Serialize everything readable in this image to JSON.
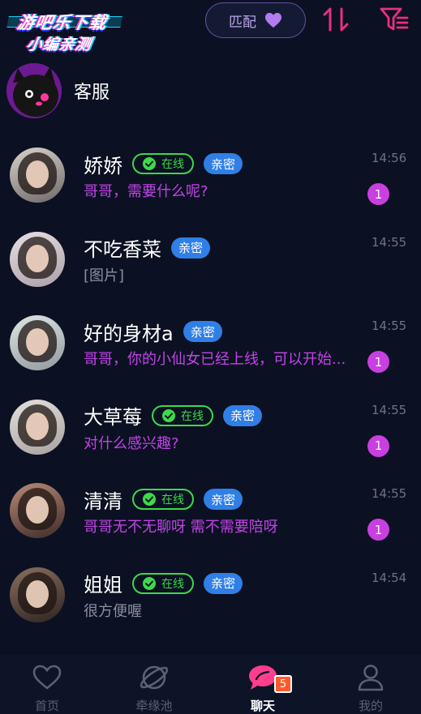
{
  "header": {
    "logo_line1": "游吧乐下载",
    "logo_line2": "小编亲测",
    "match_label": "匹配",
    "sort_icon": "sort-arrows-icon",
    "filter_icon": "filter-icon"
  },
  "service": {
    "label": "客服"
  },
  "chats": [
    {
      "name": "娇娇",
      "online": true,
      "online_label": "在线",
      "tag": "亲密",
      "message": "哥哥，需要什么呢?",
      "message_style": "pink",
      "time": "14:56",
      "unread": "1"
    },
    {
      "name": "不吃香菜",
      "online": false,
      "tag": "亲密",
      "message": "[图片]",
      "message_style": "gray",
      "time": "14:55",
      "unread": ""
    },
    {
      "name": "好的身材a",
      "online": false,
      "tag": "亲密",
      "message": "哥哥，你的小仙女已经上线，可以开始...",
      "message_style": "pink",
      "time": "14:55",
      "unread": "1"
    },
    {
      "name": "大草莓",
      "online": true,
      "online_label": "在线",
      "tag": "亲密",
      "message": "对什么感兴趣?",
      "message_style": "pink",
      "time": "14:55",
      "unread": "1"
    },
    {
      "name": "清清",
      "online": true,
      "online_label": "在线",
      "tag": "亲密",
      "message": "哥哥无不无聊呀 需不需要陪呀",
      "message_style": "pink",
      "time": "14:55",
      "unread": "1"
    },
    {
      "name": "姐姐",
      "online": true,
      "online_label": "在线",
      "tag": "亲密",
      "message": "很方便喔",
      "message_style": "gray",
      "time": "14:54",
      "unread": ""
    }
  ],
  "nav": {
    "home": "首页",
    "fate": "牵缘池",
    "chat": "聊天",
    "chat_badge": "5",
    "mine": "我的"
  },
  "colors": {
    "background": "#0b1122",
    "accent_pink": "#c243e8",
    "online_green": "#3ed84a",
    "intimate_blue": "#2f7fe6",
    "unread_badge": "#c93fe0",
    "nav_badge": "#ff5a2c"
  }
}
